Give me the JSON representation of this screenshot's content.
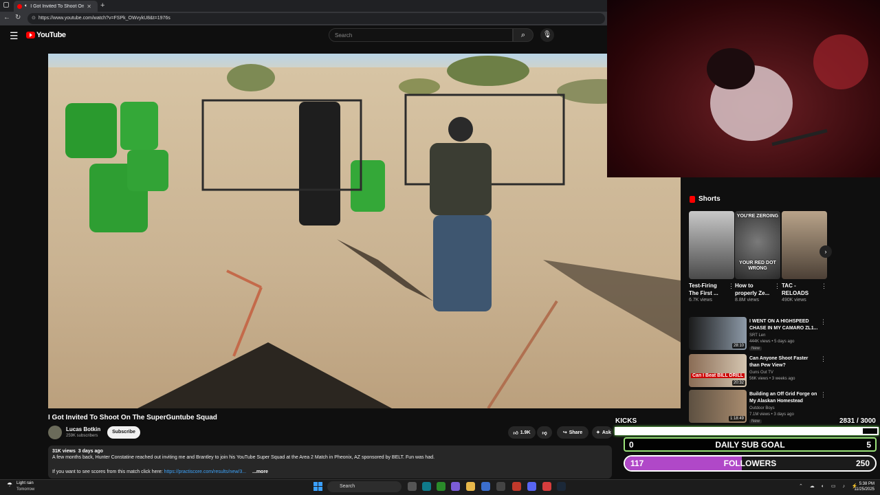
{
  "browser": {
    "tab_title": "I Got Invited To Shoot On The",
    "url": "https://www.youtube.com/watch?v=FSPk_OWvykU8&t=1976s"
  },
  "youtube": {
    "logo_text": "YouTube",
    "search_placeholder": "Search"
  },
  "video": {
    "title": "I Got Invited To Shoot On The SuperGuntube Squad",
    "channel": "Lucas Botkin",
    "subscribers": "259K subscribers",
    "subscribe_label": "Subscribe",
    "likes": "1.9K",
    "share_label": "Share",
    "ask_label": "Ask",
    "views": "31K views",
    "date": "3 days ago",
    "description_line1": "A few months back, Hunter Constatine reached out inviting me and Brantley to join his YouTube Super Squad at the Area 2 Match in Pheonix, AZ sponsored by BELT. Fun was had.",
    "description_line2_prefix": "If you want to see scores from this match click here: ",
    "description_link": "https://practiscore.com/results/new/3...",
    "more_label": "...more"
  },
  "shorts": {
    "header": "Shorts",
    "items": [
      {
        "title": "Test-Firing The First ...",
        "views": "6.7K views",
        "overlay_top": "",
        "overlay_bottom": ""
      },
      {
        "title": "How to properly Ze...",
        "views": "8.8M views",
        "overlay_top": "YOU'RE ZEROING",
        "overlay_bottom": "YOUR RED DOT WRONG"
      },
      {
        "title": "TAC - RELOADS",
        "views": "490K views",
        "overlay_top": "",
        "overlay_bottom": ""
      }
    ]
  },
  "recommended": [
    {
      "title": "I WENT ON A HIGHSPEED CHASE IN MY CAMARO ZL1...",
      "channel": "SRT Len",
      "meta": "444K views • 5 days ago",
      "badge": "New",
      "duration": "28:10"
    },
    {
      "title": "Can Anyone Shoot Faster than Pew View?",
      "channel": "Guns Out TV",
      "meta": "56K views • 3 weeks ago",
      "badge": "",
      "duration": "20:32",
      "thumb_text": "Can I Beat BILL DRILL"
    },
    {
      "title": "Building an Off Grid Forge on My Alaskan Homestead",
      "channel": "Outdoor Boys",
      "meta": "7.1M views • 3 days ago",
      "badge": "New",
      "duration": "1:18:49"
    }
  ],
  "overlay": {
    "kicks_label": "KICKS",
    "kicks_value": "2831  / 3000",
    "kicks_fraction": 0.944,
    "subgoal_left": "0",
    "subgoal_label": "DAILY SUB GOAL",
    "subgoal_right": "5",
    "followers_left": "117",
    "followers_label": "FOLLOWERS",
    "followers_right": "250",
    "followers_fraction": 0.468
  },
  "taskbar": {
    "weather": "Light rain",
    "weather_sub": "Tomorrow",
    "search": "Search",
    "time": "5:38 PM",
    "date": "11/25/2025"
  },
  "colors": {
    "accent_red": "#ff0000",
    "link_blue": "#3ea6ff",
    "followers_purple": "#b048c8",
    "subgoal_green": "#9be37a"
  }
}
